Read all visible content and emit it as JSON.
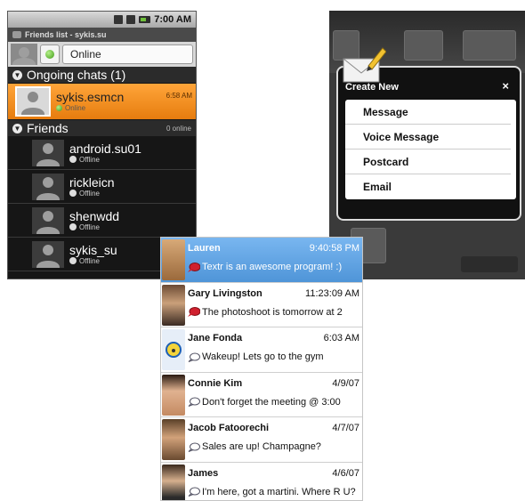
{
  "android": {
    "status_time": "7:00 AM",
    "title": "Friends list - sykis.su",
    "presence_value": "Online",
    "ongoing_header": "Ongoing chats (1)",
    "chat": {
      "name": "sykis.esmcn",
      "status": "Online",
      "time": "6:58 AM"
    },
    "friends_header": "Friends",
    "friends_count": "0 online",
    "friends": [
      {
        "name": "android.su01",
        "status": "Offline"
      },
      {
        "name": "rickleicn",
        "status": "Offline"
      },
      {
        "name": "shenwdd",
        "status": "Offline"
      },
      {
        "name": "sykis_su",
        "status": "Offline"
      }
    ]
  },
  "dialog": {
    "title": "Create New",
    "close": "×",
    "items": [
      "Message",
      "Voice Message",
      "Postcard",
      "Email"
    ]
  },
  "textr": {
    "rows": [
      {
        "name": "Lauren",
        "time": "9:40:58 PM",
        "message": "Textr is an awesome program! :)",
        "bubble": "red",
        "selected": true
      },
      {
        "name": "Gary Livingston",
        "time": "11:23:09 AM",
        "message": "The photoshoot is tomorrow at 2",
        "bubble": "red"
      },
      {
        "name": "Jane Fonda",
        "time": "6:03 AM",
        "message": "Wakeup! Lets go to the gym",
        "bubble": "outline"
      },
      {
        "name": "Connie Kim",
        "time": "4/9/07",
        "message": "Don't forget the meeting @ 3:00",
        "bubble": "outline"
      },
      {
        "name": "Jacob Fatoorechi",
        "time": "4/7/07",
        "message": "Sales are up! Champagne?",
        "bubble": "outline"
      },
      {
        "name": "James",
        "time": "4/6/07",
        "message": "I'm here, got a martini.  Where R U?",
        "bubble": "outline"
      }
    ]
  },
  "colors": {
    "orange_highlight": "#f08a1e",
    "selected_blue": "#5a9fe0",
    "bubble_red": "#d0202e",
    "online_green": "#3e9a16"
  }
}
